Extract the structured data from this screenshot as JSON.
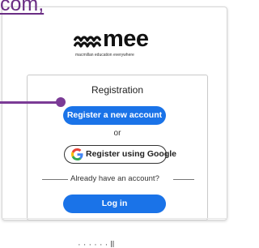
{
  "top_link": {
    "text": "com,"
  },
  "logo": {
    "wordmark": "mee",
    "tagline": "macmillan education everywhere"
  },
  "registration": {
    "title": "Registration",
    "register_button": "Register a new account",
    "or_text": "or",
    "google_button": "Register using Google",
    "divider_text": "Already have an account?",
    "login_button": "Log in"
  },
  "below_text": "·  ·  ·  ·  ·  · ll",
  "colors": {
    "primary_button": "#1a73e8",
    "pointer": "#7b3b96",
    "link": "#6a2d84"
  }
}
